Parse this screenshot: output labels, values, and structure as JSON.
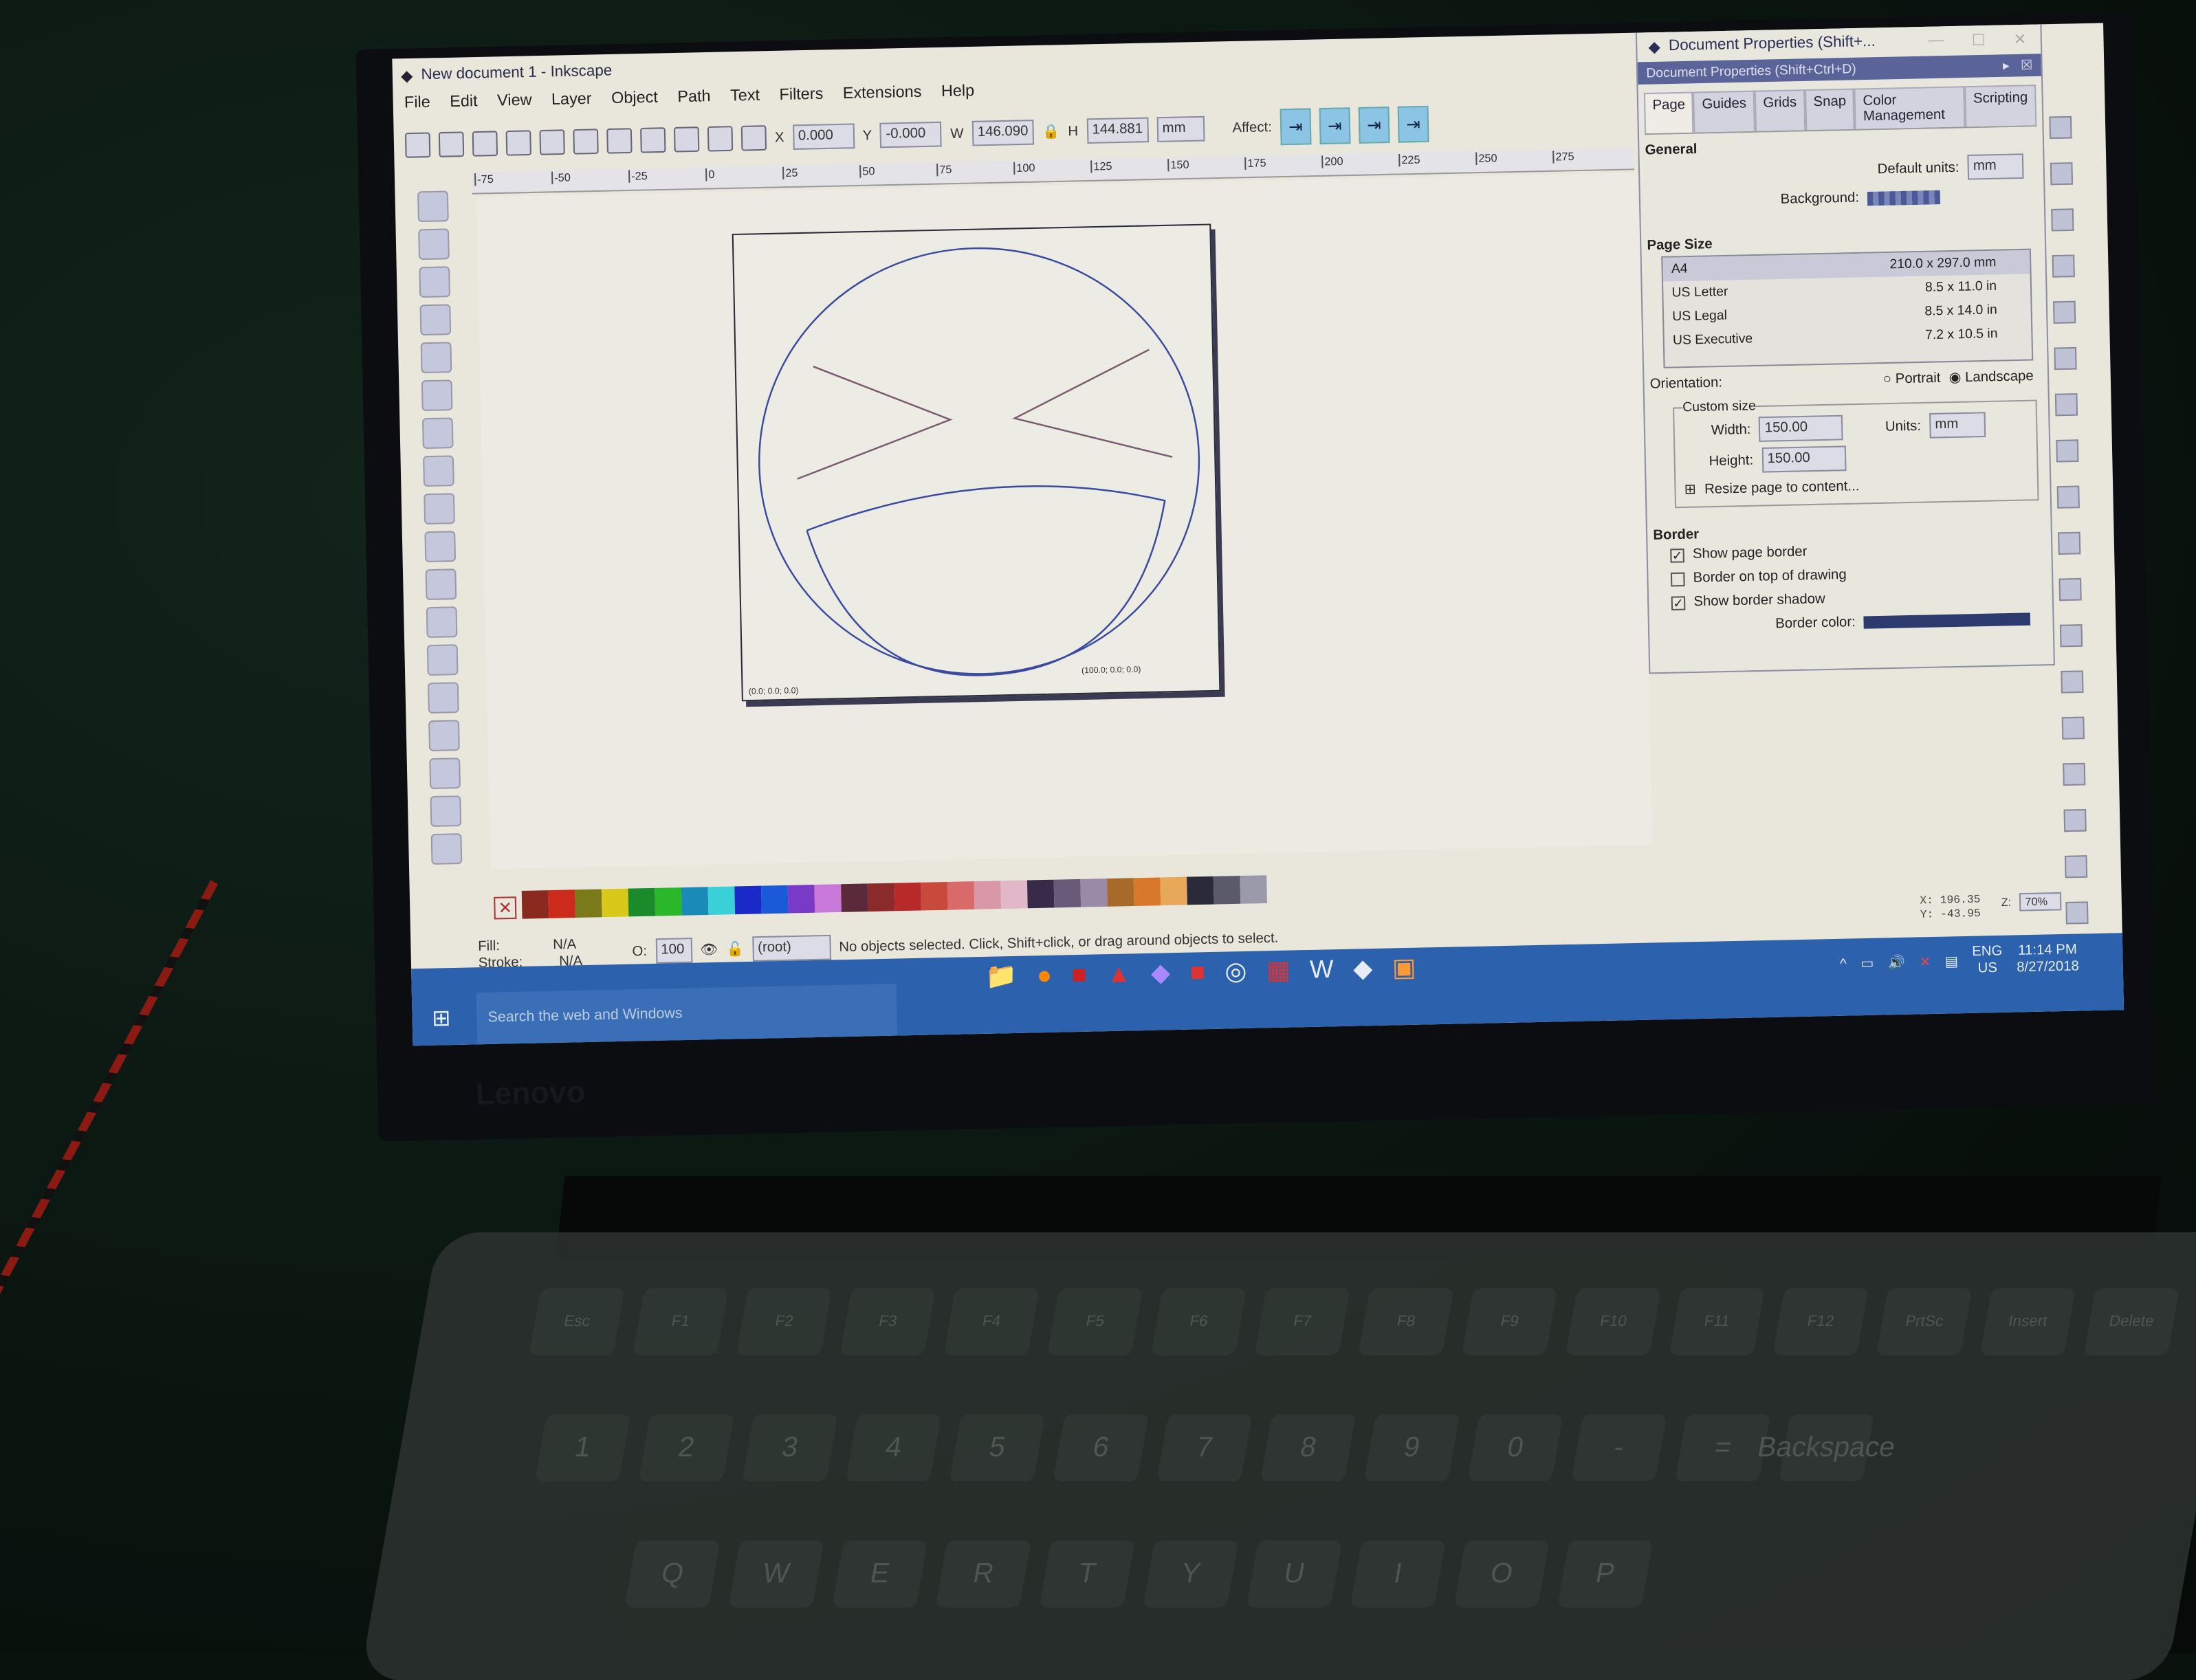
{
  "window": {
    "title": "New document 1 - Inkscape"
  },
  "menu": [
    "File",
    "Edit",
    "View",
    "Layer",
    "Object",
    "Path",
    "Text",
    "Filters",
    "Extensions",
    "Help"
  ],
  "toolbar": {
    "x_label": "X",
    "x": "0.000",
    "y_label": "Y",
    "y": "-0.000",
    "w_label": "W",
    "w": "146.090",
    "h_label": "H",
    "h": "144.881",
    "units": "mm",
    "affect_label": "Affect:"
  },
  "ruler_ticks": [
    "-75",
    "-50",
    "-25",
    "0",
    "25",
    "50",
    "75",
    "100",
    "125",
    "150",
    "175",
    "200",
    "225",
    "250",
    "275"
  ],
  "canvas": {
    "origin_label": "(0.0; 0.0; 0.0)",
    "x_label": "(100.0; 0.0; 0.0)",
    "stroke_color": "#3a4aa0"
  },
  "dialog": {
    "window_title": "Document Properties (Shift+...",
    "panel_title": "Document Properties (Shift+Ctrl+D)",
    "tabs": [
      "Page",
      "Guides",
      "Grids",
      "Snap",
      "Color Management",
      "Scripting"
    ],
    "active_tab": "Page",
    "general_heading": "General",
    "default_units_label": "Default units:",
    "default_units": "mm",
    "background_label": "Background:",
    "page_size_heading": "Page Size",
    "sizes": [
      {
        "name": "A4",
        "size": "210.0 x 297.0 mm"
      },
      {
        "name": "US Letter",
        "size": "8.5 x 11.0 in"
      },
      {
        "name": "US Legal",
        "size": "8.5 x 14.0 in"
      },
      {
        "name": "US Executive",
        "size": "7.2 x 10.5 in"
      }
    ],
    "orientation_label": "Orientation:",
    "portrait": "Portrait",
    "landscape": "Landscape",
    "orientation": "Landscape",
    "custom_size_label": "Custom size",
    "width_label": "Width:",
    "width": "150.00",
    "height_label": "Height:",
    "height": "150.00",
    "units_label": "Units:",
    "units": "mm",
    "resize_label": "Resize page to content...",
    "border_heading": "Border",
    "show_page_border": "Show page border",
    "show_page_border_checked": true,
    "border_on_top": "Border on top of drawing",
    "border_on_top_checked": false,
    "show_shadow": "Show border shadow",
    "show_shadow_checked": true,
    "border_color_label": "Border color:",
    "border_color": "#2c3a6e"
  },
  "palette": [
    "#8a2a1e",
    "#cc2a1a",
    "#7a7a1a",
    "#d8c81a",
    "#1a8a2a",
    "#2ab82a",
    "#1a8ab8",
    "#3ad0d8",
    "#1a2ac8",
    "#1a5ad8",
    "#7a3ac8",
    "#c878d8",
    "#5a2a3a",
    "#8a2a2a",
    "#b82a2a",
    "#c84a3a",
    "#d86a6a",
    "#d898a8",
    "#e0b8c8",
    "#3a2a4a",
    "#6a5a7a",
    "#9a8aa8",
    "#a86a2a",
    "#d8782a",
    "#e8a85a",
    "#2a2a3a",
    "#5a5a6a",
    "#9a9aaa"
  ],
  "status": {
    "fill_label": "Fill:",
    "fill": "N/A",
    "stroke_label": "Stroke:",
    "stroke": "N/A",
    "opacity_label": "O:",
    "opacity": "100",
    "layer": "(root)",
    "message": "No objects selected. Click, Shift+click, or drag around objects to select.",
    "cursor_x_label": "X:",
    "cursor_x": "196.35",
    "cursor_y_label": "Y:",
    "cursor_y": "-43.95",
    "zoom_label": "Z:",
    "zoom": "70%"
  },
  "taskbar": {
    "search_placeholder": "Search the web and Windows",
    "lang": "ENG",
    "region": "US",
    "time": "11:14 PM",
    "date": "8/27/2018",
    "color": "#2b61ad"
  },
  "laptop": {
    "brand": "Lenovo"
  },
  "keyboard": {
    "row1": [
      "Esc",
      "F1",
      "F2",
      "F3",
      "F4",
      "F5",
      "F6",
      "F7",
      "F8",
      "F9",
      "F10",
      "F11",
      "F12",
      "PrtSc",
      "Insert",
      "Delete"
    ],
    "row2": [
      "1",
      "2",
      "3",
      "4",
      "5",
      "6",
      "7",
      "8",
      "9",
      "0",
      "-",
      "=",
      "Backspace"
    ],
    "row3": [
      "Q",
      "W",
      "E",
      "R",
      "T",
      "Y",
      "U",
      "I",
      "O",
      "P"
    ]
  }
}
